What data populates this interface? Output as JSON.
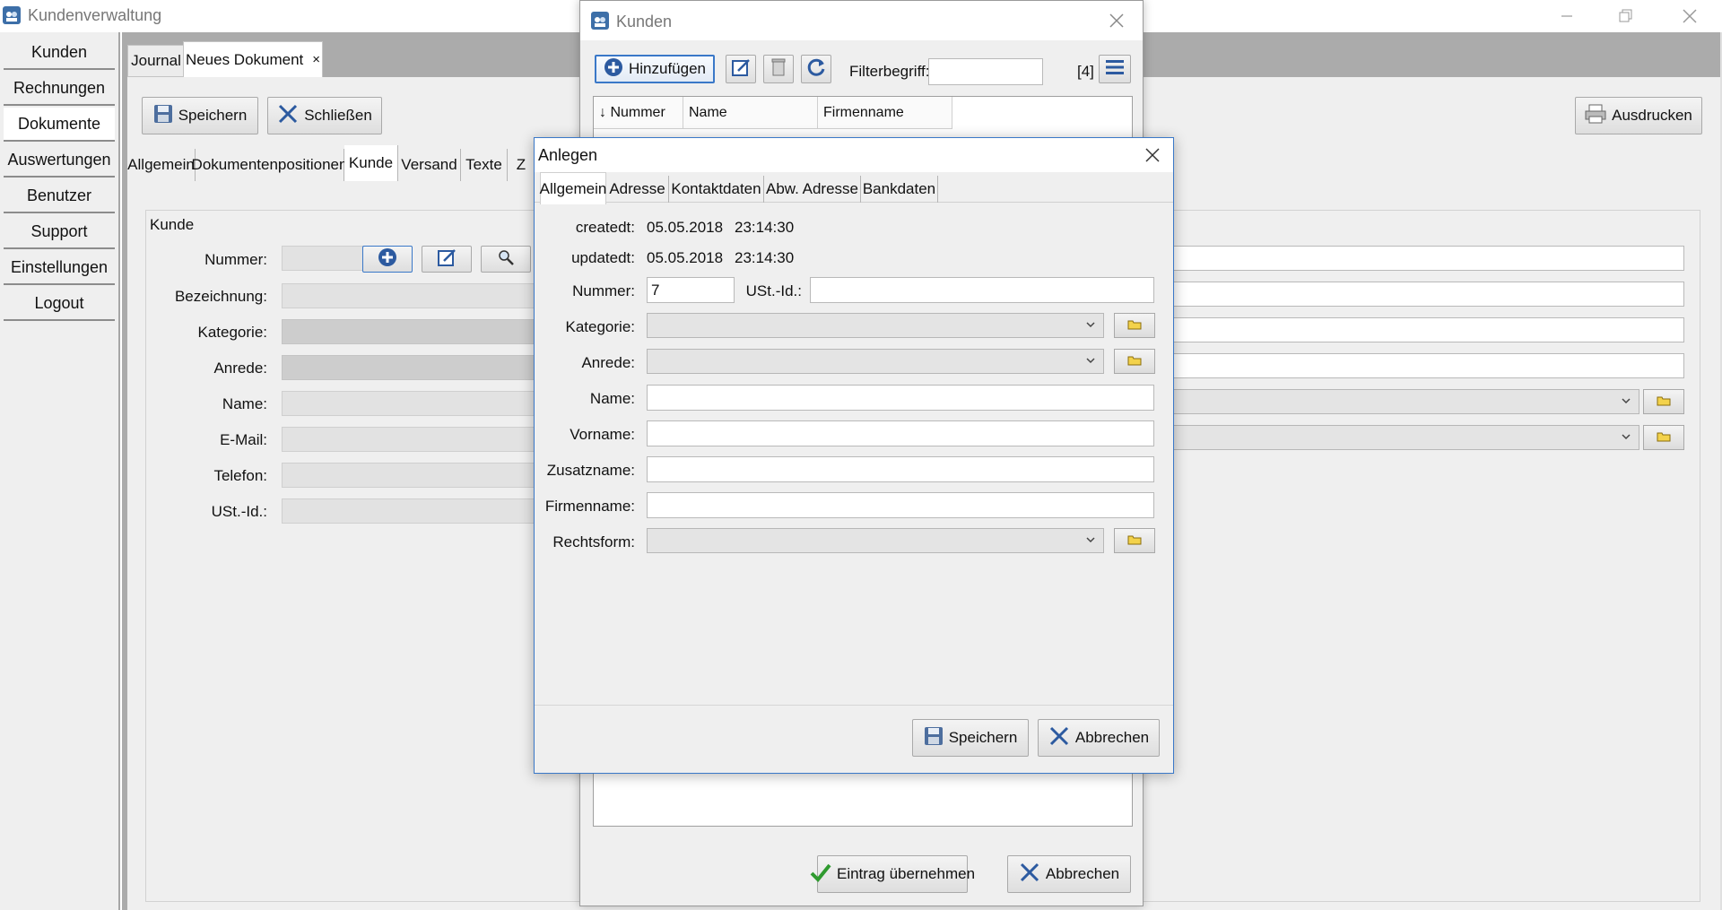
{
  "main_window": {
    "title": "Kundenverwaltung",
    "nav": [
      "Kunden",
      "Rechnungen",
      "Dokumente",
      "Auswertungen",
      "Benutzer",
      "Support",
      "Einstellungen",
      "Logout"
    ],
    "doc_tabs": {
      "journal": "Journal",
      "new_doc": "Neues Dokument",
      "close_glyph": "×"
    },
    "toolbar": {
      "save": "Speichern",
      "close": "Schließen",
      "print": "Ausdrucken"
    },
    "subtabs": [
      "Allgemein",
      "Dokumentenpositionen",
      "Kunde",
      "Versand",
      "Texte",
      "Z"
    ],
    "kunde": {
      "group_title": "Kunde",
      "labels": [
        "Nummer:",
        "Bezeichnung:",
        "Kategorie:",
        "Anrede:",
        "Name:",
        "E-Mail:",
        "Telefon:",
        "USt.-Id.:"
      ]
    }
  },
  "kunden_dialog": {
    "title": "Kunden",
    "add_label": "Hinzufügen",
    "filter_label": "Filterbegriff:",
    "filter_value": "",
    "count": "[4]",
    "columns": [
      "↓ Nummer",
      "Name",
      "Firmenname"
    ],
    "apply_label": "Eintrag übernehmen",
    "cancel_label": "Abbrechen"
  },
  "anlegen_dialog": {
    "title": "Anlegen",
    "tabs": [
      "Allgemein",
      "Adresse",
      "Kontaktdaten",
      "Abw. Adresse",
      "Bankdaten"
    ],
    "createdt": {
      "label": "createdt:",
      "date": "05.05.2018",
      "time": "23:14:30"
    },
    "updatedt": {
      "label": "updatedt:",
      "date": "05.05.2018",
      "time": "23:14:30"
    },
    "nummer": {
      "label": "Nummer:",
      "value": "7"
    },
    "ustid": {
      "label": "USt.-Id.:",
      "value": ""
    },
    "kategorie_label": "Kategorie:",
    "anrede_label": "Anrede:",
    "name_label": "Name:",
    "vorname_label": "Vorname:",
    "zusatzname_label": "Zusatzname:",
    "firmenname_label": "Firmenname:",
    "rechtsform_label": "Rechtsform:",
    "save_label": "Speichern",
    "cancel_label": "Abbrechen"
  },
  "colors": {
    "accent": "#3a78c8",
    "window_bg": "#efefef",
    "frame_grey": "#ababab"
  }
}
